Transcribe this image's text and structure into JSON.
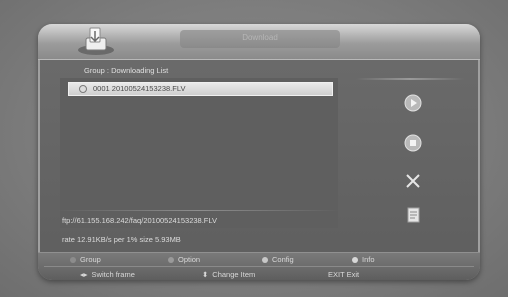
{
  "header": {
    "title": "Download"
  },
  "group_label": "Group : Downloading List",
  "list": {
    "items": [
      {
        "label": "0001  20100524153238.FLV"
      }
    ]
  },
  "info": {
    "path": "ftp://61.155.168.242/faq/20100524153238.FLV",
    "rate": "rate 12.91KB/s  per 1%  size 5.93MB"
  },
  "sidebar": {
    "icons": [
      "play-icon",
      "stop-icon",
      "delete-icon",
      "file-icon"
    ]
  },
  "footer": {
    "row1": [
      {
        "label": "Group",
        "color": "#8c8c8c"
      },
      {
        "label": "Option",
        "color": "#9a9a9a"
      },
      {
        "label": "Config",
        "color": "#c8c8c8"
      },
      {
        "label": "Info",
        "color": "#d8d8d8"
      }
    ],
    "row2": {
      "switch_frame": "Switch frame",
      "change_item": "Change Item",
      "exit": "EXIT Exit"
    }
  }
}
